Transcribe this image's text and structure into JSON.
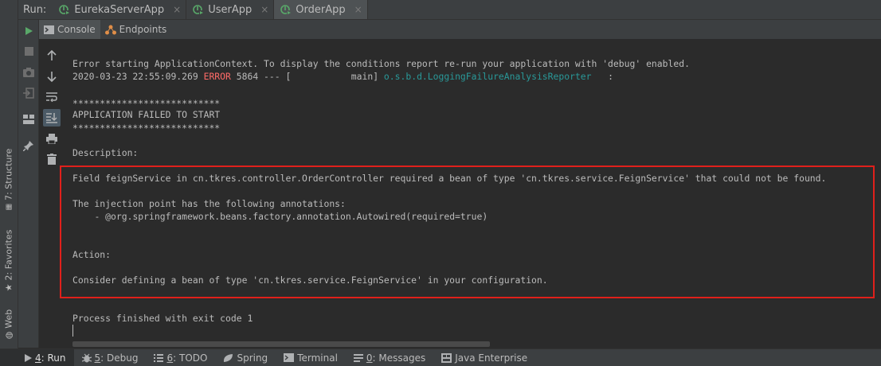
{
  "run_bar": {
    "label": "Run:",
    "tabs": [
      {
        "name": "EurekaServerApp",
        "active": false
      },
      {
        "name": "UserApp",
        "active": false
      },
      {
        "name": "OrderApp",
        "active": true
      }
    ],
    "close_glyph": "×"
  },
  "sub_tabs": [
    {
      "label": "Console",
      "active": true
    },
    {
      "label": "Endpoints",
      "active": false
    }
  ],
  "left_strip": {
    "structure": "7: Structure",
    "favorites": "2: Favorites",
    "web": "Web"
  },
  "console": {
    "line1": "Error starting ApplicationContext. To display the conditions report re-run your application with 'debug' enabled.",
    "line2_time": "2020-03-23 22:55:09.269 ",
    "line2_level": "ERROR",
    "line2_mid": " 5864 --- [           main] ",
    "line2_logger": "o.s.b.d.LoggingFailureAnalysisReporter",
    "line2_end": "   :",
    "stars": "***************************",
    "failed": "APPLICATION FAILED TO START",
    "description": "Description:",
    "field_msg": "Field feignService in cn.tkres.controller.OrderController required a bean of type 'cn.tkres.service.FeignService' that could not be found.",
    "injection": "The injection point has the following annotations:",
    "annotation": "\t- @org.springframework.beans.factory.annotation.Autowired(required=true)",
    "action": "Action:",
    "consider": "Consider defining a bean of type 'cn.tkres.service.FeignService' in your configuration.",
    "process": "Process finished with exit code 1"
  },
  "bottom_bar": [
    {
      "key": "4",
      "label": ": Run",
      "active": true,
      "icon": "play-icon"
    },
    {
      "key": "5",
      "label": ": Debug",
      "active": false,
      "icon": "bug-icon"
    },
    {
      "key": "6",
      "label": ": TODO",
      "active": false,
      "icon": "todo-icon"
    },
    {
      "key": "",
      "label": "Spring",
      "active": false,
      "icon": "spring-icon"
    },
    {
      "key": "",
      "label": "Terminal",
      "active": false,
      "icon": "terminal-icon"
    },
    {
      "key": "0",
      "label": ": Messages",
      "active": false,
      "icon": "messages-icon"
    },
    {
      "key": "",
      "label": "Java Enterprise",
      "active": false,
      "icon": "java-enterprise-icon"
    }
  ],
  "colors": {
    "error": "#ff6b68",
    "logger": "#299999",
    "highlight_box": "#e0201b",
    "run_green": "#59a869"
  }
}
